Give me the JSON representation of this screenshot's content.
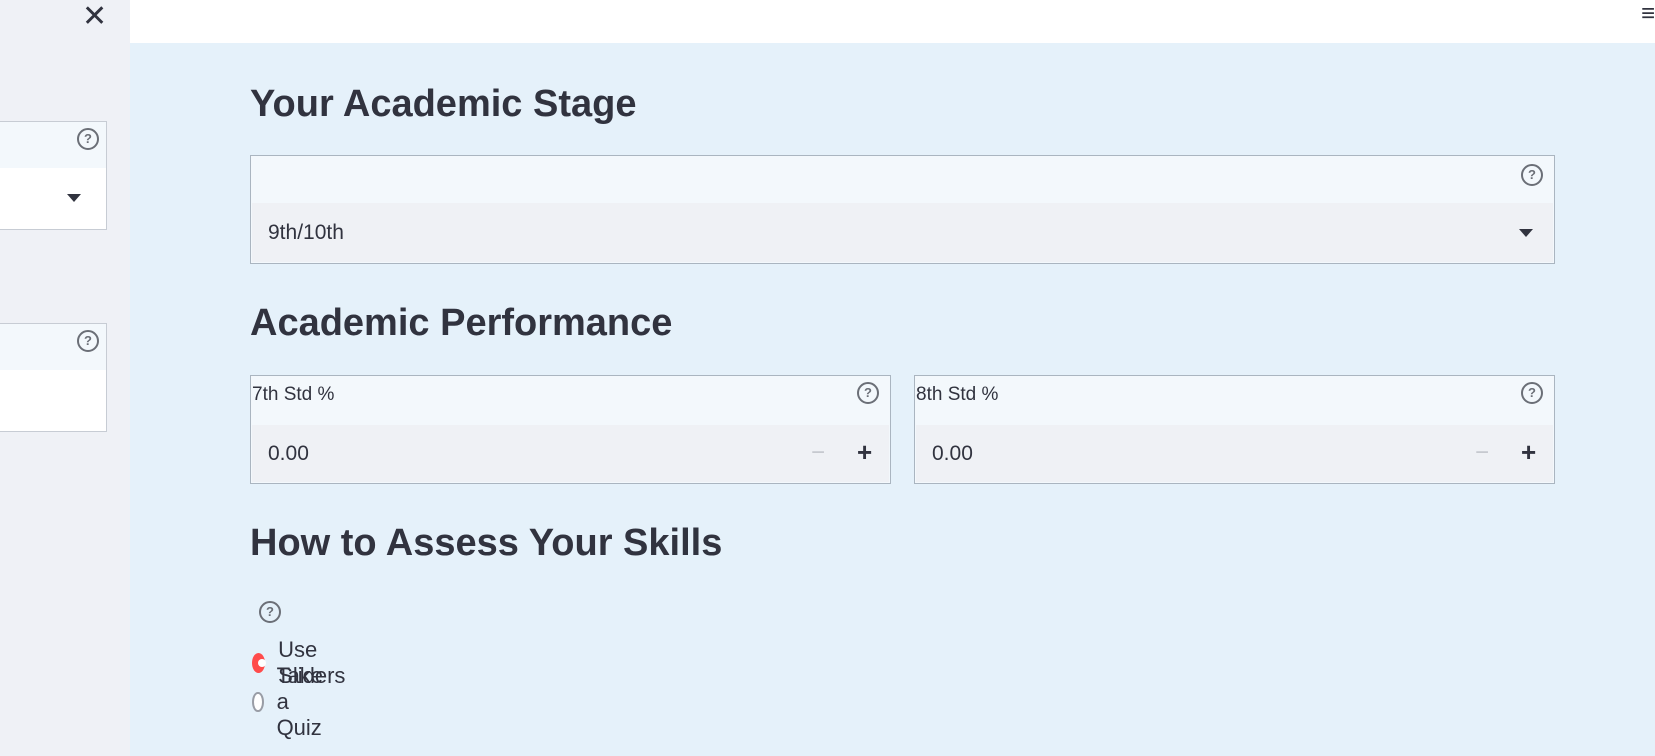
{
  "sidebar": {
    "close_glyph": "✕"
  },
  "header": {
    "menu_glyph": "≡"
  },
  "sections": {
    "academic_stage": {
      "title": "Your Academic Stage",
      "select_value": "9th/10th"
    },
    "academic_performance": {
      "title": "Academic Performance",
      "inputs": [
        {
          "label": "7th Std %",
          "value": "0.00"
        },
        {
          "label": "8th Std %",
          "value": "0.00"
        }
      ]
    },
    "assess_skills": {
      "title": "How to Assess Your Skills",
      "options": [
        {
          "label": "Use Sliders",
          "selected": true
        },
        {
          "label": "Take a Quiz",
          "selected": false
        }
      ]
    }
  },
  "glyphs": {
    "help": "?",
    "minus": "−",
    "plus": "+"
  },
  "colors": {
    "accent": "#ff4b4b",
    "main_bg": "#e5f1fa",
    "sidebar_bg": "#eff1f6"
  },
  "icons": [
    "close-icon",
    "menu-icon",
    "help-icon",
    "caret-down-icon",
    "minus-icon",
    "plus-icon"
  ]
}
